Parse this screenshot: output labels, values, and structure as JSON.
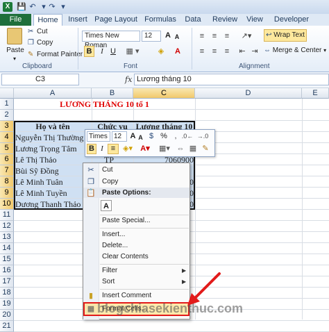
{
  "app": {
    "title": "",
    "icon": "excel-icon"
  },
  "quick_access": [
    "save-icon",
    "undo-icon",
    "redo-icon"
  ],
  "tabs": [
    {
      "label": "File"
    },
    {
      "label": "Home"
    },
    {
      "label": "Insert"
    },
    {
      "label": "Page Layout"
    },
    {
      "label": "Formulas"
    },
    {
      "label": "Data"
    },
    {
      "label": "Review"
    },
    {
      "label": "View"
    },
    {
      "label": "Developer"
    }
  ],
  "ribbon": {
    "clipboard": {
      "paste": "Paste",
      "cut": "Cut",
      "copy": "Copy",
      "format_painter": "Format Painter",
      "label": "Clipboard"
    },
    "font": {
      "name": "Times New Roman",
      "size": "12",
      "grow": "A",
      "shrink": "A",
      "bold": "B",
      "italic": "I",
      "underline": "U",
      "label": "Font"
    },
    "alignment": {
      "wrap_text": "Wrap Text",
      "merge_center": "Merge & Center",
      "label": "Alignment"
    }
  },
  "formula_bar": {
    "name_box": "C3",
    "fx": "fx",
    "content": "Lương tháng 10"
  },
  "columns": [
    "A",
    "B",
    "C",
    "D",
    "E"
  ],
  "rows": [
    "1",
    "2",
    "3",
    "4",
    "5",
    "6",
    "7",
    "8",
    "9",
    "10",
    "11",
    "12",
    "13",
    "14",
    "15",
    "16",
    "17",
    "18",
    "19",
    "20",
    "21"
  ],
  "sheet": {
    "title": "LƯƠNG THÁNG 10 tổ 1",
    "headers": [
      "Họ và tên",
      "Chức vụ",
      "Lương tháng 10"
    ],
    "names": [
      "Nguyễn Thị Thường",
      "Lương Trọng Tâm",
      "Lê Thị Thảo",
      "Bùi Sỹ Đồng",
      "Lê Minh Tuân",
      "Lê Minh Tuyền",
      "Dương Thanh Thảo"
    ],
    "role_row6": "TP",
    "salary_row6": "7060900",
    "partial_digits": [
      "0",
      "0",
      "0"
    ]
  },
  "mini_toolbar": {
    "font": "Times Ne",
    "size": "12",
    "grow": "A",
    "shrink": "A",
    "bold": "B",
    "italic": "I",
    "percent": "%"
  },
  "context_menu": {
    "cut": "Cut",
    "copy": "Copy",
    "paste_options": "Paste Options:",
    "paste_icon": "A",
    "paste_special": "Paste Special...",
    "insert": "Insert...",
    "delete": "Delete...",
    "clear_contents": "Clear Contents",
    "filter": "Filter",
    "sort": "Sort",
    "insert_comment": "Insert Comment",
    "format_cells": "Format Cells..."
  },
  "watermark": "blogchiasekienthuc.com",
  "colors": {
    "file_tab": "#1f6f3b",
    "title_red": "#e00000",
    "highlight": "#e21b1b",
    "selection": "#cfe0f3"
  }
}
